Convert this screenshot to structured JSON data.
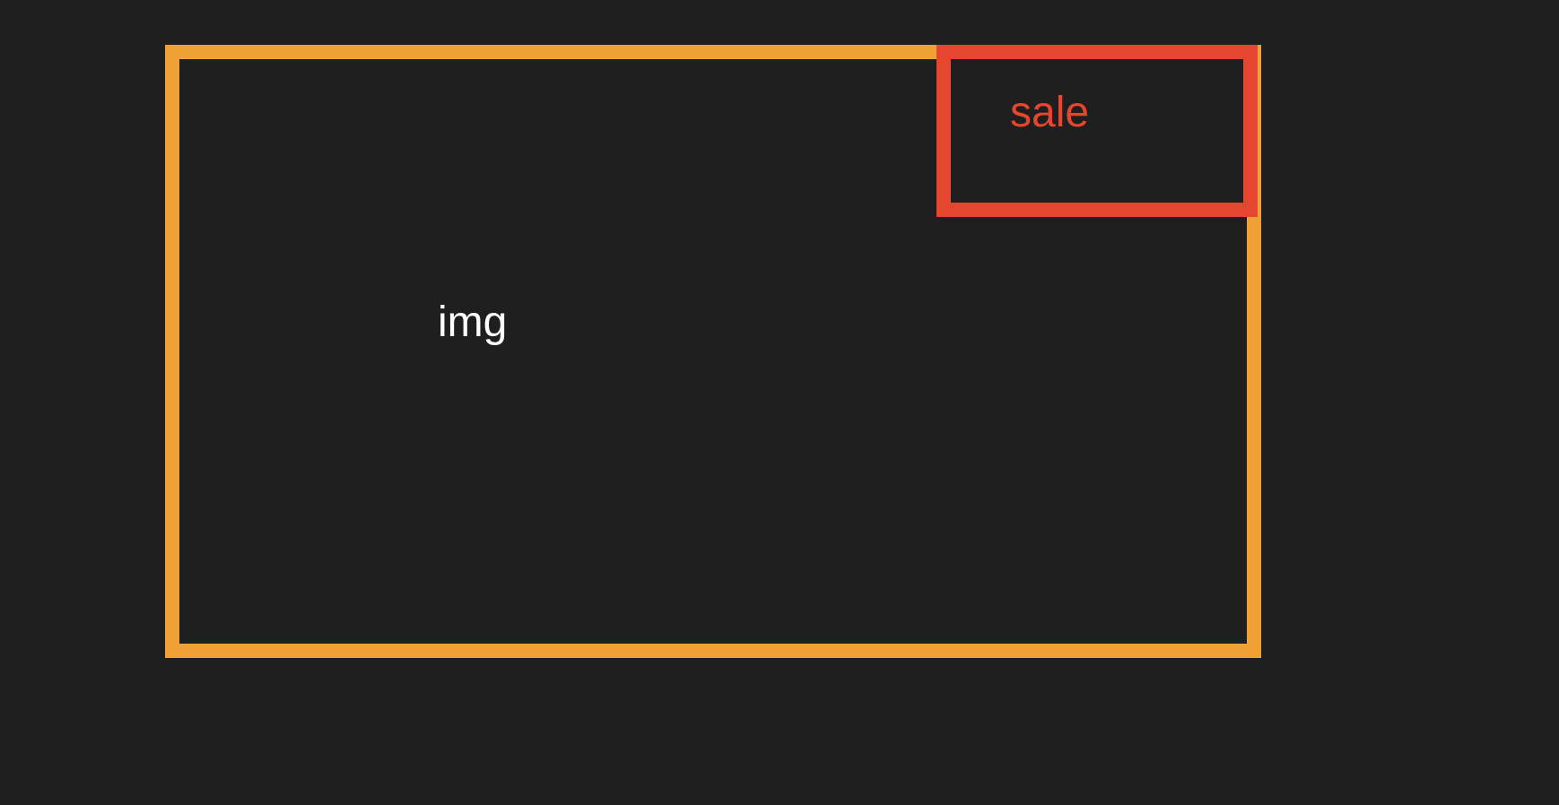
{
  "diagram": {
    "img_box": {
      "label": "img",
      "border_color": "#f0a135",
      "text_color": "#ffffff"
    },
    "sale_box": {
      "label": "sale",
      "border_color": "#e4462f",
      "text_color": "#e4462f"
    },
    "background": "#1f1f1f"
  }
}
